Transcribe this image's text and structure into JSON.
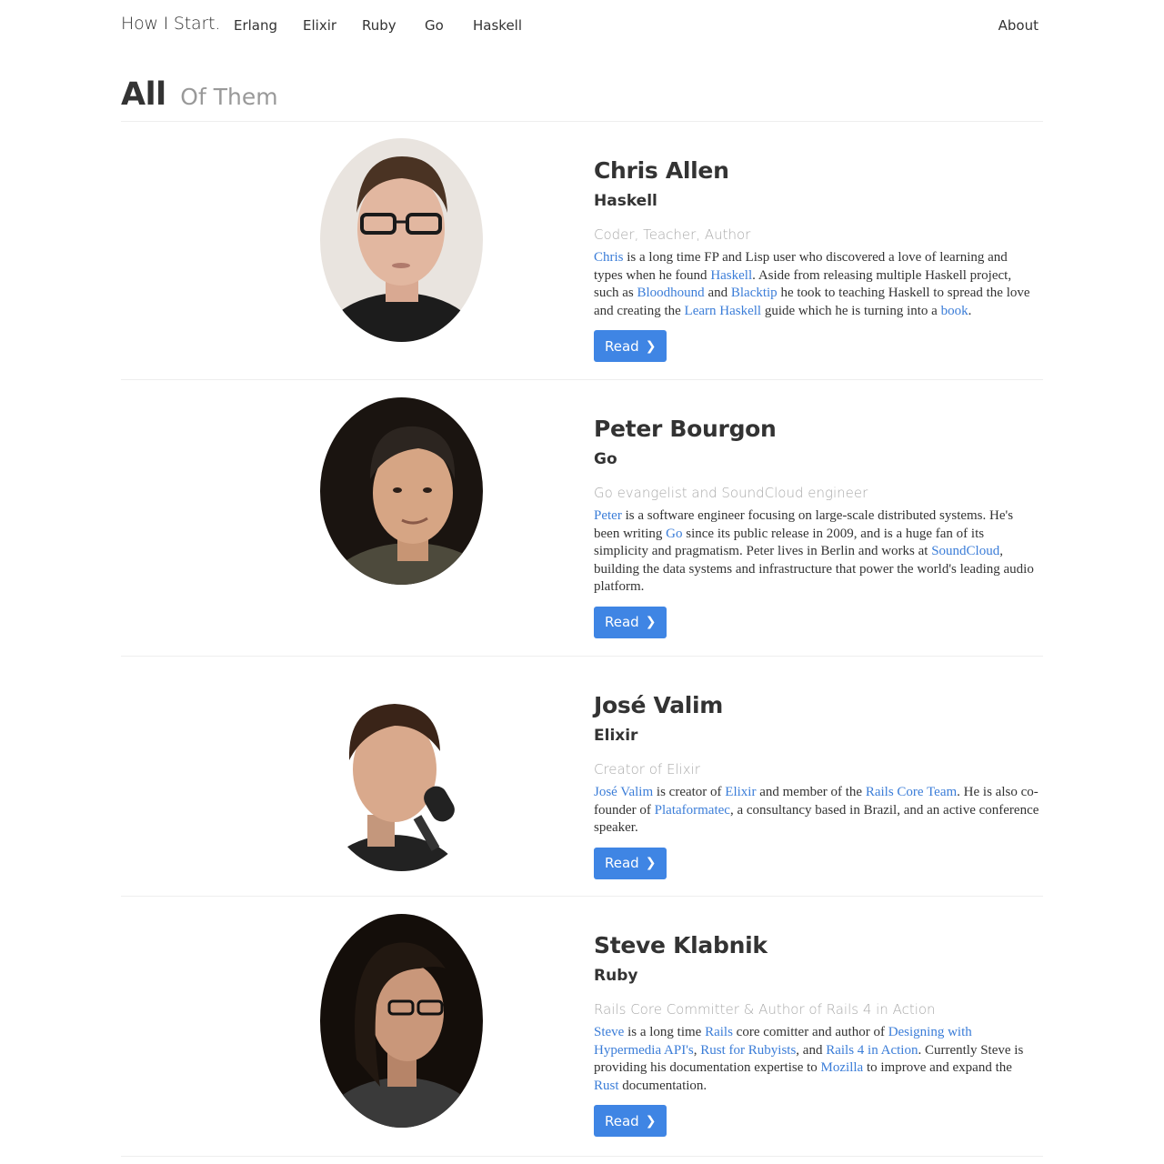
{
  "nav": {
    "brand": "How I Start.",
    "links": [
      "Erlang",
      "Elixir",
      "Ruby",
      "Go",
      "Haskell"
    ],
    "about": "About"
  },
  "header": {
    "title": "All",
    "subtitle": "Of Them"
  },
  "colors": {
    "link": "#3b7dd8",
    "button": "#3f85e4",
    "muted": "#aaaaaa"
  },
  "people": [
    {
      "name": "Chris Allen",
      "language": "Haskell",
      "tagline": "Coder, Teacher, Author",
      "bio": [
        {
          "t": "Chris",
          "link": true
        },
        {
          "t": " is a long time FP and Lisp user who discovered a love of learning and types when he found "
        },
        {
          "t": "Haskell",
          "link": true
        },
        {
          "t": ". Aside from releasing multiple Haskell project, such as "
        },
        {
          "t": "Bloodhound",
          "link": true
        },
        {
          "t": " and "
        },
        {
          "t": "Blacktip",
          "link": true
        },
        {
          "t": " he took to teaching Haskell to spread the love and creating the "
        },
        {
          "t": "Learn Haskell",
          "link": true
        },
        {
          "t": " guide which he is turning into a "
        },
        {
          "t": "book",
          "link": true
        },
        {
          "t": "."
        }
      ],
      "button": "Read"
    },
    {
      "name": "Peter Bourgon",
      "language": "Go",
      "tagline": "Go evangelist and SoundCloud engineer",
      "bio": [
        {
          "t": "Peter",
          "link": true
        },
        {
          "t": " is a software engineer focusing on large-scale distributed systems. He's been writing "
        },
        {
          "t": "Go",
          "link": true
        },
        {
          "t": " since its public release in 2009, and is a huge fan of its simplicity and pragmatism. Peter lives in Berlin and works at "
        },
        {
          "t": "SoundCloud",
          "link": true
        },
        {
          "t": ", building the data systems and infrastructure that power the world's leading audio platform."
        }
      ],
      "button": "Read"
    },
    {
      "name": "José Valim",
      "language": "Elixir",
      "tagline": "Creator of Elixir",
      "bio": [
        {
          "t": "José Valim",
          "link": true
        },
        {
          "t": " is creator of "
        },
        {
          "t": "Elixir",
          "link": true
        },
        {
          "t": " and member of the "
        },
        {
          "t": "Rails Core Team",
          "link": true
        },
        {
          "t": ". He is also co-founder of "
        },
        {
          "t": "Plataformatec",
          "link": true
        },
        {
          "t": ", a consultancy based in Brazil, and an active conference speaker."
        }
      ],
      "button": "Read"
    },
    {
      "name": "Steve Klabnik",
      "language": "Ruby",
      "tagline": "Rails Core Committer & Author of Rails 4 in Action",
      "bio": [
        {
          "t": "Steve",
          "link": true
        },
        {
          "t": " is a long time "
        },
        {
          "t": "Rails",
          "link": true
        },
        {
          "t": " core comitter and author of "
        },
        {
          "t": "Designing with Hypermedia API's",
          "link": true
        },
        {
          "t": ", "
        },
        {
          "t": "Rust for Rubyists",
          "link": true
        },
        {
          "t": ", and "
        },
        {
          "t": "Rails 4 in Action",
          "link": true
        },
        {
          "t": ". Currently Steve is providing his documentation expertise to "
        },
        {
          "t": "Mozilla",
          "link": true
        },
        {
          "t": " to improve and expand the "
        },
        {
          "t": "Rust",
          "link": true
        },
        {
          "t": " documentation."
        }
      ],
      "button": "Read"
    }
  ]
}
